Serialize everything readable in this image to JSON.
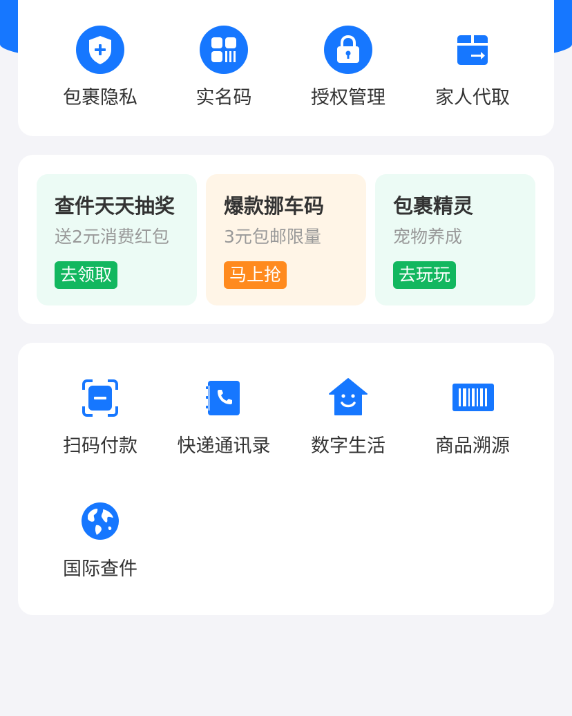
{
  "colors": {
    "brand_blue": "#1677ff",
    "green_button": "#12b75f",
    "orange_button": "#ff8a1e",
    "mint_bg": "#ecfbf5",
    "peach_bg": "#fff5e7"
  },
  "services": [
    {
      "label": "包裹隐私",
      "icon": "shield-plus-icon"
    },
    {
      "label": "实名码",
      "icon": "qr-code-icon"
    },
    {
      "label": "授权管理",
      "icon": "lock-icon"
    },
    {
      "label": "家人代取",
      "icon": "box-arrow-icon"
    }
  ],
  "promos": [
    {
      "title": "查件天天抽奖",
      "subtitle": "送2元消费红包",
      "button": "去领取"
    },
    {
      "title": "爆款挪车码",
      "subtitle": "3元包邮限量",
      "button": "马上抢"
    },
    {
      "title": "包裹精灵",
      "subtitle": "宠物养成",
      "button": "去玩玩"
    }
  ],
  "tools": [
    {
      "label": "扫码付款",
      "icon": "scan-icon"
    },
    {
      "label": "快递通讯录",
      "icon": "phone-book-icon"
    },
    {
      "label": "数字生活",
      "icon": "smile-house-icon"
    },
    {
      "label": "商品溯源",
      "icon": "barcode-icon"
    },
    {
      "label": "国际查件",
      "icon": "globe-icon"
    }
  ]
}
